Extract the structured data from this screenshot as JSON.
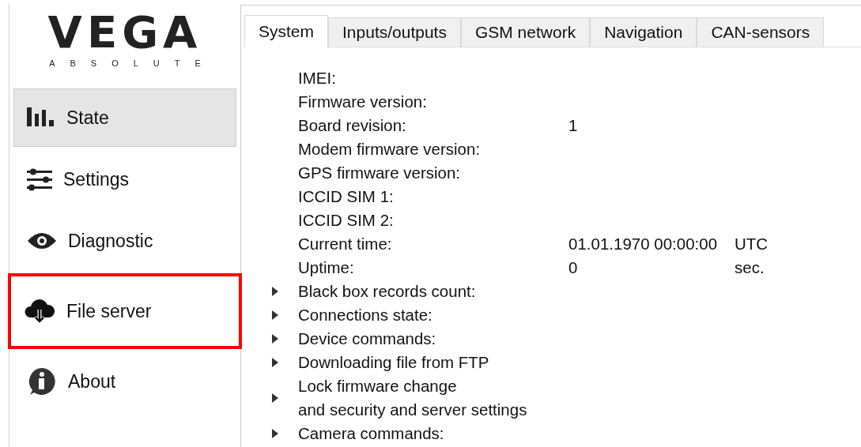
{
  "logo": {
    "name": "VEGA",
    "tagline": "ABSOLUTE"
  },
  "sidebar": {
    "items": [
      {
        "label": "State",
        "selected": true,
        "highlighted": false
      },
      {
        "label": "Settings",
        "selected": false,
        "highlighted": false
      },
      {
        "label": "Diagnostic",
        "selected": false,
        "highlighted": false
      },
      {
        "label": "File server",
        "selected": false,
        "highlighted": true
      },
      {
        "label": "About",
        "selected": false,
        "highlighted": false
      }
    ]
  },
  "tabs": [
    {
      "label": "System",
      "selected": true
    },
    {
      "label": "Inputs/outputs",
      "selected": false
    },
    {
      "label": "GSM network",
      "selected": false
    },
    {
      "label": "Navigation",
      "selected": false
    },
    {
      "label": "CAN-sensors",
      "selected": false
    }
  ],
  "rows": [
    {
      "kind": "field",
      "label": "IMEI:"
    },
    {
      "kind": "field",
      "label": "Firmware version:"
    },
    {
      "kind": "field",
      "label": "Board revision:",
      "value": "1"
    },
    {
      "kind": "field",
      "label": "Modem firmware version:"
    },
    {
      "kind": "field",
      "label": "GPS firmware version:"
    },
    {
      "kind": "field",
      "label": "ICCID SIM 1:"
    },
    {
      "kind": "field",
      "label": "ICCID SIM 2:"
    },
    {
      "kind": "field",
      "label": "Current time:",
      "value": "01.01.1970 00:00:00",
      "unit": "UTC"
    },
    {
      "kind": "field",
      "label": "Uptime:",
      "value": "0",
      "unit": "sec."
    },
    {
      "kind": "group",
      "label": "Black box records count:",
      "expanded": false
    },
    {
      "kind": "group",
      "label": "Connections state:",
      "expanded": false
    },
    {
      "kind": "group",
      "label": "Device commands:",
      "expanded": false
    },
    {
      "kind": "group",
      "label": "Downloading file from FTP",
      "expanded": false
    },
    {
      "kind": "group",
      "label": "Lock firmware change\nand security and server settings",
      "expanded": false
    },
    {
      "kind": "group",
      "label": "Camera commands:",
      "expanded": false
    }
  ]
}
